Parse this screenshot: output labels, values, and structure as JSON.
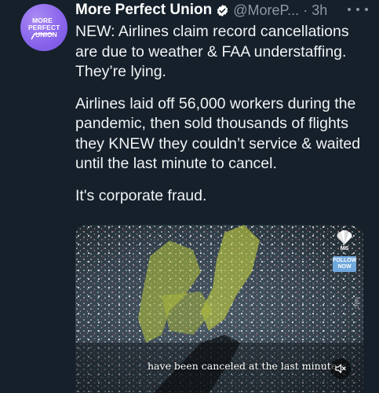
{
  "tweet": {
    "display_name": "More Perfect Union",
    "handle": "@MoreP...",
    "separator": "·",
    "time": "3h",
    "avatar_lines": [
      "MORE",
      "PERFECT",
      "UNION"
    ],
    "paragraphs": [
      "NEW: Airlines claim record cancellations are due to weather & FAA understaffing. They’re lying.",
      "Airlines laid off 56,000 workers during the pandemic, then sold thousands of flights they KNEW they couldn’t service & waited until the last minute to cancel.",
      "It's corporate fraud."
    ]
  },
  "video": {
    "caption": "have been canceled at the last minute",
    "follow_label": "FOLLOW NOW",
    "network_short": "MS",
    "side_text": "NBC",
    "mute_icon": "speaker-muted-icon"
  },
  "colors": {
    "background": "#15202b",
    "text": "#f1f3f4",
    "secondary": "#8b98a5",
    "avatar": "#8a66ec",
    "verified": "#1d9bf0"
  }
}
